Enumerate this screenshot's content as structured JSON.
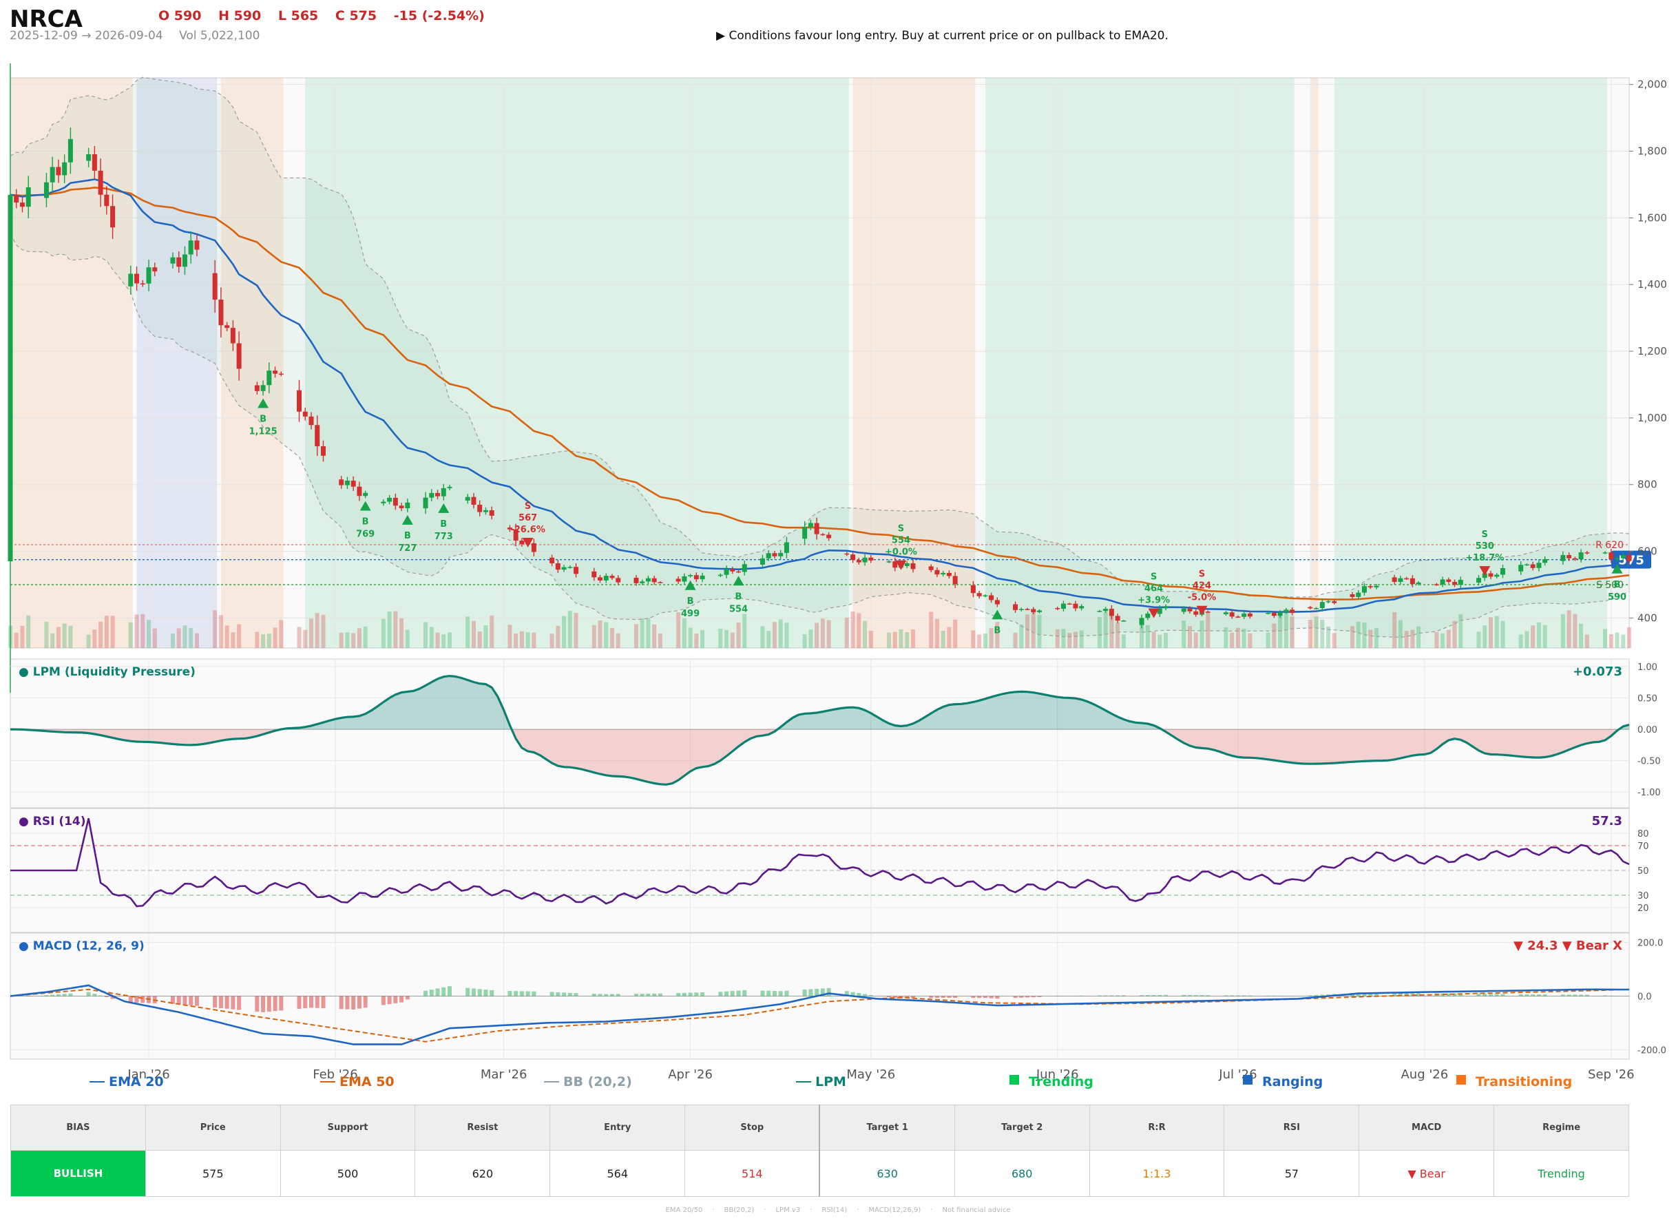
{
  "header": {
    "ticker": "NRCA",
    "open": "O 590",
    "high": "H 590",
    "low": "L 565",
    "close": "C 575",
    "change": "-15  (-2.54%)",
    "range": "2025-12-09 → 2026-09-04",
    "volume": "Vol 5,022,100",
    "note": "▶  Conditions favour long entry. Buy at current price or on pullback to EMA20."
  },
  "colors": {
    "up": "#16a34a",
    "down": "#d32f2f",
    "ema20": "#1f66c2",
    "ema50": "#d9620f",
    "bb": "#9e9e9e",
    "lpm": "#0c8070",
    "rsi": "#5b1889",
    "macd": "#1f66c2",
    "signal": "#d9620f",
    "trending": "#00c853",
    "ranging": "#1f66c2",
    "transitioning": "#f97316"
  },
  "chart_data": {
    "type": "candlestick",
    "x_range": [
      "2025-12-09",
      "2026-09-04"
    ],
    "x_ticks": [
      "Jan '26",
      "Feb '26",
      "Mar '26",
      "Apr '26",
      "May '26",
      "Jun '26",
      "Jul '26",
      "Aug '26",
      "Sep '26"
    ],
    "x_tick_dates": [
      "2026-01-01",
      "2026-02-01",
      "2026-03-01",
      "2026-04-01",
      "2026-05-01",
      "2026-06-01",
      "2026-07-01",
      "2026-08-01",
      "2026-09-01"
    ],
    "price": {
      "ylim": [
        310,
        2020
      ],
      "y_ticks": [
        400,
        600,
        800,
        1000,
        1200,
        1400,
        1600,
        1800,
        2000
      ],
      "y_tick_labels": [
        "400",
        "600",
        "800",
        "1,000",
        "1,200",
        "1,400",
        "1,600",
        "1,800",
        "2,000"
      ],
      "last_price": 575,
      "last_price_label": "575",
      "resistance": 620,
      "resistance_label": "R 620",
      "support": 500,
      "support_label": "S 500",
      "regimes": [
        {
          "from": "2025-12-09",
          "to": "2025-12-29",
          "regime": "transitioning"
        },
        {
          "from": "2025-12-30",
          "to": "2026-01-12",
          "regime": "ranging"
        },
        {
          "from": "2026-01-13",
          "to": "2026-01-23",
          "regime": "transitioning"
        },
        {
          "from": "2026-01-27",
          "to": "2026-04-27",
          "regime": "trending"
        },
        {
          "from": "2026-04-28",
          "to": "2026-05-18",
          "regime": "transitioning"
        },
        {
          "from": "2026-05-20",
          "to": "2026-07-10",
          "regime": "trending"
        },
        {
          "from": "2026-07-13",
          "to": "2026-07-14",
          "regime": "transitioning"
        },
        {
          "from": "2026-07-17",
          "to": "2026-08-31",
          "regime": "trending"
        }
      ],
      "signals": [
        {
          "date": "2026-01-20",
          "type": "B",
          "price": "1,125",
          "pct": ""
        },
        {
          "date": "2026-02-06",
          "type": "B",
          "price": "769",
          "pct": ""
        },
        {
          "date": "2026-02-13",
          "type": "B",
          "price": "727",
          "pct": ""
        },
        {
          "date": "2026-02-19",
          "type": "B",
          "price": "773",
          "pct": ""
        },
        {
          "date": "2026-03-05",
          "type": "S",
          "price": "567",
          "pct": "-26.6%"
        },
        {
          "date": "2026-04-01",
          "type": "B",
          "price": "499",
          "pct": ""
        },
        {
          "date": "2026-04-09",
          "type": "B",
          "price": "554",
          "pct": ""
        },
        {
          "date": "2026-05-06",
          "type": "S",
          "price": "554",
          "pct": "+0.0%"
        },
        {
          "date": "2026-05-22",
          "type": "B",
          "price": "",
          "pct": ""
        },
        {
          "date": "2026-06-17",
          "type": "S",
          "price": "464",
          "pct": "+3.9%"
        },
        {
          "date": "2026-06-25",
          "type": "S",
          "price": "424",
          "pct": "-5.0%"
        },
        {
          "date": "2026-08-11",
          "type": "S",
          "price": "530",
          "pct": "+18.7%"
        },
        {
          "date": "2026-09-02",
          "type": "B",
          "price": "590",
          "pct": ""
        }
      ],
      "ema20_label": "EMA 20",
      "ema50_label": "EMA 50",
      "bb_label": "BB (20,2)"
    },
    "lpm": {
      "title": "● LPM (Liquidity Pressure)",
      "last_label": "+0.073",
      "ylim": [
        -1.25,
        1.12
      ],
      "y_ticks": [
        1.0,
        0.5,
        0.0,
        -0.5,
        -1.0
      ],
      "y_tick_labels": [
        "1.00",
        "0.50",
        "0.00",
        "-0.50",
        "-1.00"
      ],
      "points": [
        [
          "2025-12-09",
          0.0
        ],
        [
          "2025-12-20",
          -0.05
        ],
        [
          "2025-12-31",
          -0.2
        ],
        [
          "2026-01-08",
          -0.25
        ],
        [
          "2026-01-16",
          -0.15
        ],
        [
          "2026-01-25",
          0.02
        ],
        [
          "2026-02-04",
          0.2
        ],
        [
          "2026-02-13",
          0.6
        ],
        [
          "2026-02-20",
          0.85
        ],
        [
          "2026-02-26",
          0.72
        ],
        [
          "2026-03-05",
          -0.35
        ],
        [
          "2026-03-11",
          -0.6
        ],
        [
          "2026-03-20",
          -0.75
        ],
        [
          "2026-03-28",
          -0.88
        ],
        [
          "2026-04-03",
          -0.6
        ],
        [
          "2026-04-13",
          -0.1
        ],
        [
          "2026-04-20",
          0.25
        ],
        [
          "2026-04-28",
          0.35
        ],
        [
          "2026-05-06",
          0.05
        ],
        [
          "2026-05-15",
          0.4
        ],
        [
          "2026-05-26",
          0.6
        ],
        [
          "2026-06-03",
          0.5
        ],
        [
          "2026-06-15",
          0.1
        ],
        [
          "2026-06-25",
          -0.3
        ],
        [
          "2026-07-02",
          -0.45
        ],
        [
          "2026-07-13",
          -0.55
        ],
        [
          "2026-07-25",
          -0.5
        ],
        [
          "2026-08-01",
          -0.4
        ],
        [
          "2026-08-06",
          -0.15
        ],
        [
          "2026-08-12",
          -0.4
        ],
        [
          "2026-08-20",
          -0.45
        ],
        [
          "2026-08-30",
          -0.2
        ],
        [
          "2026-09-04",
          0.073
        ]
      ]
    },
    "rsi": {
      "title": "● RSI (14)",
      "last_label": "57.3",
      "ylim": [
        0,
        100
      ],
      "y_ticks": [
        80,
        70,
        50,
        30,
        20
      ],
      "y_tick_labels": [
        "80",
        "70",
        "50",
        "30",
        "20"
      ],
      "points": [
        [
          "2025-12-09",
          50
        ],
        [
          "2025-12-20",
          50
        ],
        [
          "2025-12-22",
          92
        ],
        [
          "2025-12-24",
          40
        ],
        [
          "2025-12-30",
          22
        ],
        [
          "2026-01-03",
          32
        ],
        [
          "2026-01-12",
          42
        ],
        [
          "2026-01-18",
          33
        ],
        [
          "2026-01-25",
          40
        ],
        [
          "2026-02-01",
          25
        ],
        [
          "2026-02-06",
          30
        ],
        [
          "2026-02-13",
          35
        ],
        [
          "2026-02-20",
          38
        ],
        [
          "2026-02-28",
          32
        ],
        [
          "2026-03-08",
          28
        ],
        [
          "2026-03-18",
          26
        ],
        [
          "2026-03-28",
          35
        ],
        [
          "2026-04-08",
          34
        ],
        [
          "2026-04-17",
          55
        ],
        [
          "2026-04-21",
          65
        ],
        [
          "2026-04-28",
          50
        ],
        [
          "2026-05-06",
          45
        ],
        [
          "2026-05-15",
          40
        ],
        [
          "2026-05-24",
          35
        ],
        [
          "2026-06-01",
          38
        ],
        [
          "2026-06-08",
          40
        ],
        [
          "2026-06-15",
          25
        ],
        [
          "2026-06-20",
          42
        ],
        [
          "2026-06-27",
          48
        ],
        [
          "2026-07-03",
          45
        ],
        [
          "2026-07-10",
          40
        ],
        [
          "2026-07-17",
          55
        ],
        [
          "2026-07-24",
          62
        ],
        [
          "2026-08-01",
          58
        ],
        [
          "2026-08-08",
          60
        ],
        [
          "2026-08-15",
          64
        ],
        [
          "2026-08-22",
          66
        ],
        [
          "2026-08-28",
          68
        ],
        [
          "2026-09-02",
          62
        ],
        [
          "2026-09-04",
          57.3
        ]
      ]
    },
    "macd": {
      "title": "● MACD (12, 26, 9)",
      "last_label": "▼ 24.3 ▼ Bear X",
      "ylim": [
        -235,
        235
      ],
      "y_ticks": [
        200,
        0,
        -200
      ],
      "y_tick_labels": [
        "200.0",
        "0.0",
        "-200.0"
      ],
      "macd_points": [
        [
          "2025-12-09",
          0
        ],
        [
          "2025-12-15",
          15
        ],
        [
          "2025-12-22",
          40
        ],
        [
          "2025-12-28",
          -20
        ],
        [
          "2026-01-06",
          -60
        ],
        [
          "2026-01-13",
          -100
        ],
        [
          "2026-01-20",
          -140
        ],
        [
          "2026-01-28",
          -150
        ],
        [
          "2026-02-04",
          -180
        ],
        [
          "2026-02-12",
          -180
        ],
        [
          "2026-02-20",
          -120
        ],
        [
          "2026-02-28",
          -110
        ],
        [
          "2026-03-08",
          -100
        ],
        [
          "2026-03-18",
          -95
        ],
        [
          "2026-03-28",
          -80
        ],
        [
          "2026-04-06",
          -60
        ],
        [
          "2026-04-16",
          -30
        ],
        [
          "2026-04-24",
          10
        ],
        [
          "2026-05-02",
          -10
        ],
        [
          "2026-05-12",
          -20
        ],
        [
          "2026-05-22",
          -35
        ],
        [
          "2026-06-01",
          -30
        ],
        [
          "2026-06-11",
          -25
        ],
        [
          "2026-06-21",
          -20
        ],
        [
          "2026-07-01",
          -15
        ],
        [
          "2026-07-11",
          -10
        ],
        [
          "2026-07-21",
          10
        ],
        [
          "2026-08-01",
          15
        ],
        [
          "2026-08-15",
          20
        ],
        [
          "2026-08-28",
          25
        ],
        [
          "2026-09-04",
          24.3
        ]
      ],
      "signal_points": [
        [
          "2025-12-09",
          0
        ],
        [
          "2025-12-22",
          25
        ],
        [
          "2026-01-06",
          -30
        ],
        [
          "2026-01-20",
          -80
        ],
        [
          "2026-02-04",
          -130
        ],
        [
          "2026-02-16",
          -170
        ],
        [
          "2026-02-28",
          -130
        ],
        [
          "2026-03-12",
          -110
        ],
        [
          "2026-03-28",
          -90
        ],
        [
          "2026-04-10",
          -70
        ],
        [
          "2026-04-24",
          -20
        ],
        [
          "2026-05-06",
          -5
        ],
        [
          "2026-05-20",
          -25
        ],
        [
          "2026-06-05",
          -30
        ],
        [
          "2026-06-20",
          -25
        ],
        [
          "2026-07-05",
          -15
        ],
        [
          "2026-07-25",
          0
        ],
        [
          "2026-08-10",
          10
        ],
        [
          "2026-08-28",
          20
        ],
        [
          "2026-09-04",
          25
        ]
      ]
    },
    "legend": {
      "ema20": "EMA 20",
      "ema50": "EMA 50",
      "bb": "BB (20,2)",
      "lpm": "LPM",
      "trending": "Trending",
      "ranging": "Ranging",
      "transitioning": "Transitioning"
    }
  },
  "summary": {
    "headers": [
      "BIAS",
      "Price",
      "Support",
      "Resist",
      "Entry",
      "Stop",
      "Target 1",
      "Target 2",
      "R:R",
      "RSI",
      "MACD",
      "Regime"
    ],
    "values": [
      "BULLISH",
      "575",
      "500",
      "620",
      "564",
      "514",
      "630",
      "680",
      "1:1.3",
      "57",
      "▼ Bear",
      "Trending"
    ],
    "value_colors": [
      "#ffffff",
      "#222222",
      "#222222",
      "#222222",
      "#222222",
      "#d32f2f",
      "#0c7a6e",
      "#0c7a6e",
      "#e07b00",
      "#222222",
      "#d32f2f",
      "#16a34a"
    ]
  },
  "footer": [
    "EMA 20/50",
    "BB(20,2)",
    "LPM v3",
    "RSI(14)",
    "MACD(12,26,9)",
    "Not financial advice"
  ]
}
